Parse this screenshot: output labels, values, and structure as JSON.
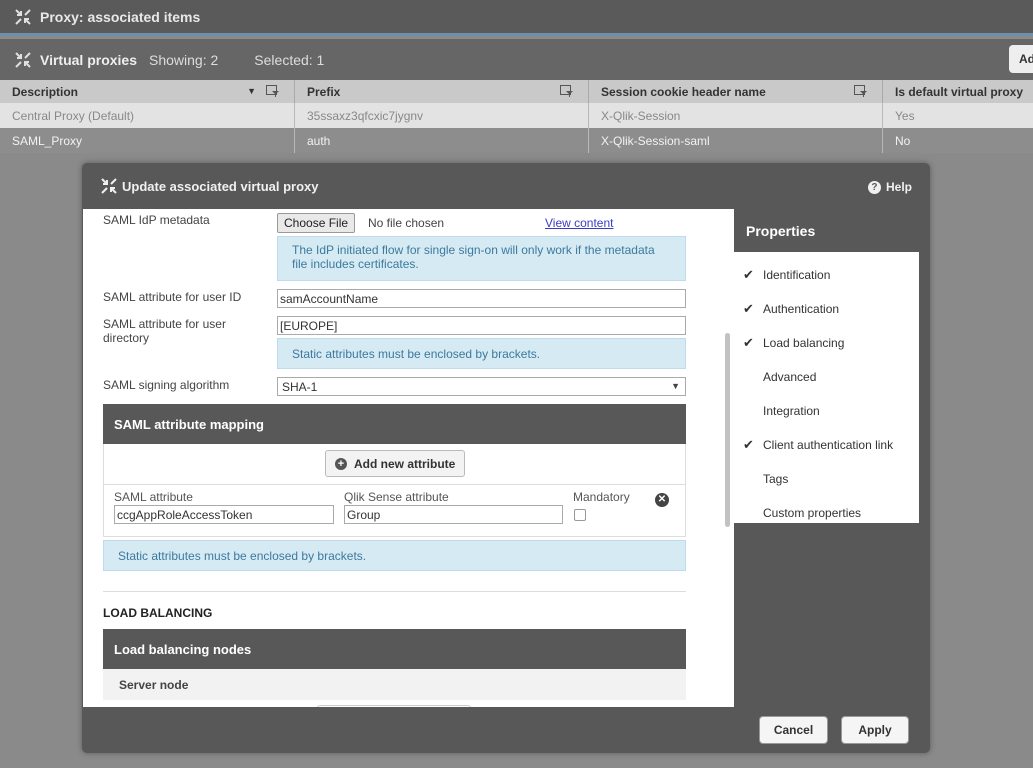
{
  "header": {
    "title": "Proxy: associated items",
    "icon": "shrink-arrows-icon"
  },
  "subbar": {
    "title": "Virtual proxies",
    "showing": "Showing: 2",
    "selected": "Selected: 1",
    "add_label": "Ad"
  },
  "table": {
    "columns": [
      "Description",
      "Prefix",
      "Session cookie header name",
      "Is default virtual proxy"
    ],
    "rows": [
      [
        "Central Proxy (Default)",
        "35ssaxz3qfcxic7jygnv",
        "X-Qlik-Session",
        "Yes"
      ],
      [
        "SAML_Proxy",
        "auth",
        "X-Qlik-Session-saml",
        "No"
      ]
    ]
  },
  "modal": {
    "title": "Update associated virtual proxy",
    "help": "Help",
    "form": {
      "idp_label": "SAML IdP metadata",
      "choose_file": "Choose File",
      "no_file": "No file chosen",
      "view_content": "View content",
      "idp_info": "The IdP initiated flow for single sign-on will only work if the metadata file includes certificates.",
      "userid_label": "SAML attribute for user ID",
      "userid_value": "samAccountName",
      "userdir_label": "SAML attribute for user directory",
      "userdir_value": "[EUROPE]",
      "userdir_info": "Static attributes must be enclosed by brackets.",
      "signing_label": "SAML signing algorithm",
      "signing_value": "SHA-1"
    },
    "mapping": {
      "title": "SAML attribute mapping",
      "add_label": "Add new attribute",
      "saml_attr_label": "SAML attribute",
      "saml_attr_value": "ccgAppRoleAccessToken",
      "qlik_attr_label": "Qlik Sense attribute",
      "qlik_attr_value": "Group",
      "mandatory_label": "Mandatory",
      "info": "Static attributes must be enclosed by brackets."
    },
    "load_balancing": {
      "section_title": "LOAD BALANCING",
      "nodes_title": "Load balancing nodes",
      "server_node": "Server node"
    },
    "properties": {
      "title": "Properties",
      "items": [
        {
          "label": "Identification",
          "checked": true
        },
        {
          "label": "Authentication",
          "checked": true
        },
        {
          "label": "Load balancing",
          "checked": true
        },
        {
          "label": "Advanced",
          "checked": false
        },
        {
          "label": "Integration",
          "checked": false
        },
        {
          "label": "Client authentication link",
          "checked": true
        },
        {
          "label": "Tags",
          "checked": false
        },
        {
          "label": "Custom properties",
          "checked": false
        }
      ]
    },
    "buttons": {
      "cancel": "Cancel",
      "apply": "Apply"
    }
  },
  "colors": {
    "dark": "#585858",
    "info_bg": "#d6eaf3",
    "info_text": "#3c7a9e",
    "accent_line": "#6e8fa8"
  }
}
